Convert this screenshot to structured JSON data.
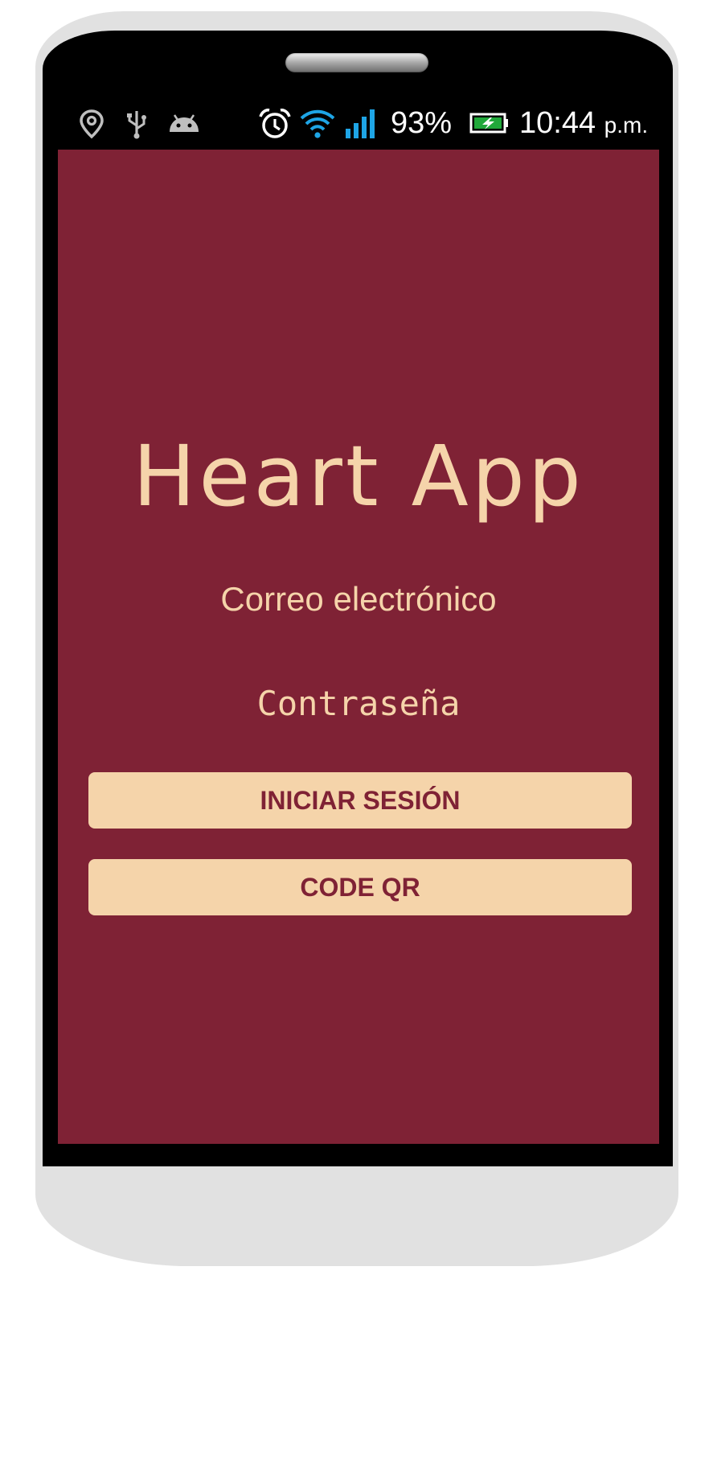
{
  "status_bar": {
    "icons": [
      "location-icon",
      "usb-icon",
      "android-icon",
      "alarm-icon",
      "wifi-icon",
      "signal-icon",
      "battery-charging-icon"
    ],
    "battery_percent": "93%",
    "time": "10:44",
    "ampm": "p.m."
  },
  "app": {
    "title": "Heart App",
    "email_placeholder": "Correo electrónico",
    "password_placeholder": "Contraseña",
    "login_button": "INICIAR SESIÓN",
    "qr_button": "CODE QR"
  },
  "colors": {
    "background": "#7f2235",
    "accent": "#f5d4aa",
    "wifi": "#1ea5e6"
  }
}
